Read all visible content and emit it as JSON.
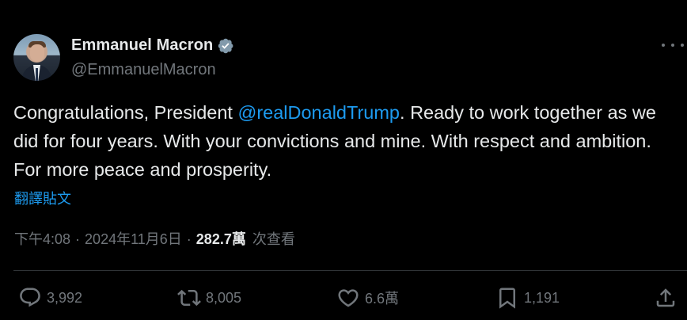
{
  "author": {
    "display_name": "Emmanuel Macron",
    "handle": "@EmmanuelMacron",
    "verified": true
  },
  "tweet": {
    "text_before": "Congratulations, President ",
    "mention": "@realDonaldTrump",
    "text_after": ". Ready to work together as we did for four years. With your convictions and mine. With respect and ambition. For more peace and prosperity.",
    "translate_label": "翻譯貼文"
  },
  "meta": {
    "time": "下午4:08",
    "separator": "·",
    "date": "2024年11月6日",
    "views_count": "282.7萬",
    "views_label": "次查看"
  },
  "actions": {
    "replies": "3,992",
    "reposts": "8,005",
    "likes": "6.6萬",
    "bookmarks": "1,191"
  },
  "colors": {
    "background": "#000000",
    "text": "#e7e9ea",
    "secondary": "#71767b",
    "accent": "#1d9bf0",
    "divider": "#2f3336"
  },
  "icons": [
    "verified-badge-icon",
    "more-icon",
    "reply-icon",
    "repost-icon",
    "like-icon",
    "bookmark-icon",
    "share-icon"
  ]
}
